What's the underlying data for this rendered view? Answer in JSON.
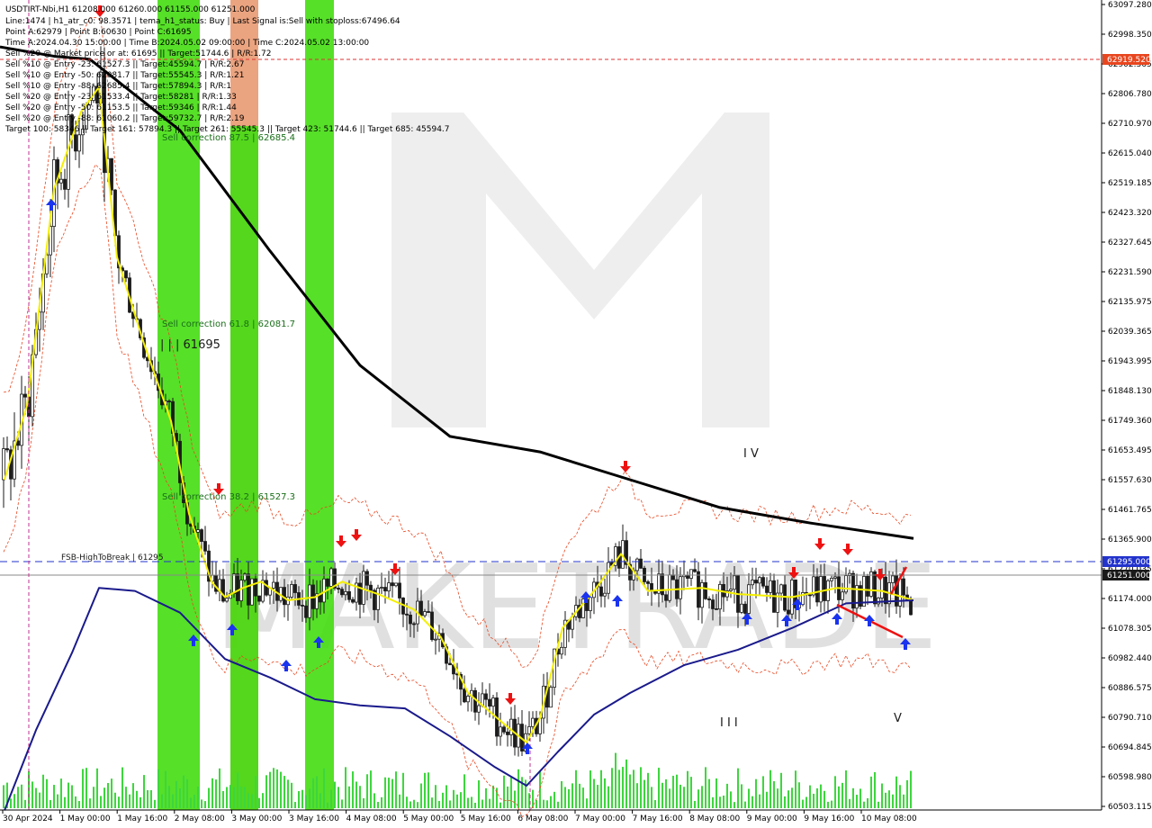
{
  "header": {
    "symbol_line": "USDTIRT-Nbi,H1  61208.000 61260.000 61155.000 61251.000",
    "lines": [
      "Line:1474 | h1_atr_c0: 98.3571 | tema_h1_status: Buy | Last Signal is:Sell with stoploss:67496.64",
      "Point A:62979 | Point B:60630 | Point C:61695",
      "Time A:2024.04.30 15:00:00 | Time B:2024.05.02 09:00:00 | Time C:2024.05.02 13:00:00",
      "Sell %20 @ Market price or at: 61695 || Target:51744.6 | R/R:1.72",
      "Sell %10 @ Entry -23: 61527.3 || Target:45594.7 | R/R:2.67",
      "Sell %10 @ Entry -50: 62081.7 || Target:55545.3 | R/R:1.21",
      "Sell %10 @ Entry -88: 62685.4 || Target:57894.3 | R/R:1",
      "Sell %20 @ Entry -23: 61533.4 || Target:58281 | R/R:1.33",
      "Sell %20 @ Entry -50: 61153.5 || Target:59346 | R/R:1.44",
      "Sell %20 @ Entry -88: 61060.2 || Target:59732.7 | R/R:2.19",
      "Target 100: 58346 || Target 161: 57894.3 || Target 261: 55545.3 || Target 423: 51744.6 || Target 685: 45594.7"
    ]
  },
  "annotations": {
    "sell_correction_875": "Sell correction 87.5 | 62685.4",
    "sell_correction_618": "Sell correction 61.8 | 62081.7",
    "sell_correction_382": "Sell correction 38.2 | 61527.3",
    "point_c_label": "| | | 61695",
    "fsb_label": "FSB-HighToBreak | 61295",
    "wave_iv": "I V",
    "wave_iii": "I I I",
    "wave_v": "V"
  },
  "price_tags": {
    "red_level": "62919.520",
    "blue_level": "61295.000",
    "current": "61251.000",
    "hidden": "61270.000"
  },
  "chart_data": {
    "type": "candlestick",
    "ylim": [
      60503.115,
      63097.28
    ],
    "y_ticks": [
      "63097.280",
      "62998.350",
      "62902.365",
      "62806.780",
      "62710.970",
      "62615.040",
      "62519.185",
      "62423.320",
      "62327.645",
      "62231.590",
      "62135.975",
      "62039.365",
      "61943.995",
      "61848.130",
      "61749.360",
      "61653.495",
      "61557.630",
      "61461.765",
      "61365.900",
      "61270.035",
      "61174.000",
      "61078.305",
      "60982.440",
      "60886.575",
      "60790.710",
      "60694.845",
      "60598.980",
      "60503.115"
    ],
    "x_ticks": [
      "30 Apr 2024",
      "1 May 00:00",
      "1 May 16:00",
      "2 May 08:00",
      "3 May 00:00",
      "3 May 16:00",
      "4 May 08:00",
      "5 May 00:00",
      "5 May 16:00",
      "6 May 08:00",
      "7 May 00:00",
      "7 May 16:00",
      "8 May 08:00",
      "9 May 00:00",
      "9 May 16:00",
      "10 May 08:00"
    ],
    "levels": {
      "red_dashed": 62919.52,
      "blue_dashed": 61295.0,
      "current_price": 61251.0
    },
    "series": [
      {
        "name": "",
        "kind": "MA",
        "color": "#000000",
        "points": [
          [
            0,
            62960
          ],
          [
            60,
            62930
          ],
          [
            100,
            62920
          ],
          [
            200,
            62690
          ],
          [
            300,
            62300
          ],
          [
            400,
            61930
          ],
          [
            500,
            61700
          ],
          [
            600,
            61650
          ],
          [
            700,
            61560
          ],
          [
            800,
            61470
          ],
          [
            900,
            61420
          ],
          [
            1015,
            61370
          ]
        ]
      },
      {
        "name": "",
        "kind": "MA",
        "color": "#f5f000",
        "points": [
          [
            5,
            61560
          ],
          [
            30,
            61800
          ],
          [
            60,
            62500
          ],
          [
            90,
            62750
          ],
          [
            110,
            62830
          ],
          [
            130,
            62280
          ],
          [
            160,
            62000
          ],
          [
            190,
            61750
          ],
          [
            210,
            61450
          ],
          [
            235,
            61230
          ],
          [
            250,
            61180
          ],
          [
            270,
            61210
          ],
          [
            290,
            61230
          ],
          [
            320,
            61170
          ],
          [
            350,
            61180
          ],
          [
            380,
            61230
          ],
          [
            420,
            61190
          ],
          [
            460,
            61140
          ],
          [
            490,
            61050
          ],
          [
            520,
            60870
          ],
          [
            560,
            60770
          ],
          [
            585,
            60710
          ],
          [
            600,
            60790
          ],
          [
            625,
            61080
          ],
          [
            660,
            61200
          ],
          [
            690,
            61320
          ],
          [
            720,
            61200
          ],
          [
            780,
            61210
          ],
          [
            820,
            61190
          ],
          [
            880,
            61180
          ],
          [
            930,
            61210
          ],
          [
            980,
            61200
          ],
          [
            1015,
            61170
          ]
        ]
      },
      {
        "name": "",
        "kind": "MA",
        "color": "#1a1a8c",
        "points": [
          [
            5,
            60490
          ],
          [
            40,
            60750
          ],
          [
            80,
            61000
          ],
          [
            110,
            61210
          ],
          [
            150,
            61200
          ],
          [
            200,
            61130
          ],
          [
            250,
            60980
          ],
          [
            300,
            60920
          ],
          [
            350,
            60850
          ],
          [
            400,
            60830
          ],
          [
            450,
            60820
          ],
          [
            500,
            60730
          ],
          [
            550,
            60630
          ],
          [
            585,
            60570
          ],
          [
            620,
            60680
          ],
          [
            660,
            60800
          ],
          [
            700,
            60870
          ],
          [
            760,
            60960
          ],
          [
            820,
            61010
          ],
          [
            880,
            61080
          ],
          [
            940,
            61160
          ],
          [
            1015,
            61170
          ]
        ]
      }
    ]
  }
}
